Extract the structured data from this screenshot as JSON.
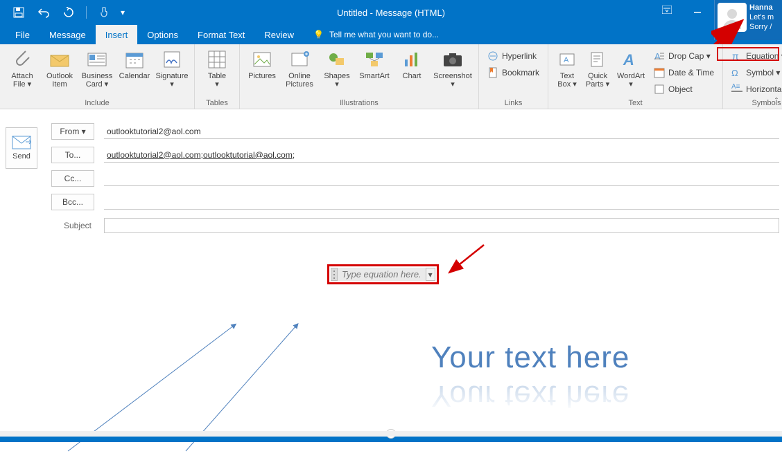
{
  "title": "Untitled - Message (HTML)",
  "user": {
    "name": "Hanna",
    "line1": "Let's m",
    "line2": "Sorry /"
  },
  "menu": {
    "file": "File",
    "message": "Message",
    "insert": "Insert",
    "options": "Options",
    "formatText": "Format Text",
    "review": "Review",
    "tellMe": "Tell me what you want to do..."
  },
  "ribbon": {
    "include": {
      "caption": "Include",
      "attachFile": "Attach\nFile ▾",
      "outlookItem": "Outlook\nItem",
      "businessCard": "Business\nCard ▾",
      "calendar": "Calendar",
      "signature": "Signature\n▾"
    },
    "tables": {
      "caption": "Tables",
      "table": "Table\n▾"
    },
    "illustrations": {
      "caption": "Illustrations",
      "pictures": "Pictures",
      "onlinePictures": "Online\nPictures",
      "shapes": "Shapes\n▾",
      "smartArt": "SmartArt",
      "chart": "Chart",
      "screenshot": "Screenshot\n▾"
    },
    "links": {
      "caption": "Links",
      "hyperlink": "Hyperlink",
      "bookmark": "Bookmark"
    },
    "text": {
      "caption": "Text",
      "textBox": "Text\nBox ▾",
      "quickParts": "Quick\nParts ▾",
      "wordArt": "WordArt\n▾",
      "dropCap": "Drop Cap ▾",
      "dateTime": "Date & Time",
      "object": "Object"
    },
    "symbols": {
      "caption": "Symbols",
      "equation": "Equation ▾",
      "symbol": "Symbol ▾",
      "horizLine": "Horizontal Line"
    }
  },
  "compose": {
    "send": "Send",
    "fromLabel": "From ▾",
    "fromValue": "outlooktutorial2@aol.com",
    "toLabel": "To...",
    "toAddr1": "outlooktutorial2@aol.com",
    "toAddr2": "outlooktutorial@aol.com",
    "ccLabel": "Cc...",
    "bccLabel": "Bcc...",
    "subjectLabel": "Subject"
  },
  "body": {
    "equationPlaceholder": "Type equation here.",
    "wordArtText": "Your text here"
  },
  "colors": {
    "brand": "#0173C7",
    "highlight": "#d40000",
    "wordart": "#4F81BD"
  }
}
